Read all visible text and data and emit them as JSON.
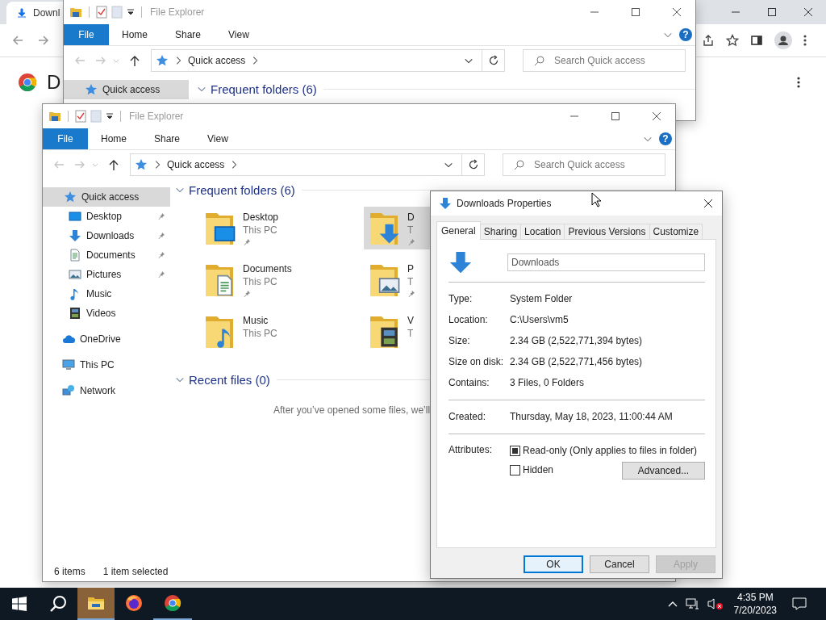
{
  "browser": {
    "tab_title": "Downl",
    "page_heading": "D"
  },
  "background_explorer": {
    "title": "File Explorer",
    "ribbon_tabs": [
      {
        "label": "File",
        "kind": "menu"
      },
      {
        "label": "Home",
        "kind": "tab"
      },
      {
        "label": "Share",
        "kind": "tab"
      },
      {
        "label": "View",
        "kind": "tab"
      }
    ],
    "help": "?",
    "address": "Quick access",
    "search_placeholder": "Search Quick access",
    "nav_item": {
      "label": "Quick access",
      "selected": true
    },
    "section": "Frequent folders (6)"
  },
  "explorer": {
    "title": "File Explorer",
    "ribbon_tabs": [
      {
        "label": "File",
        "kind": "menu"
      },
      {
        "label": "Home",
        "kind": "tab"
      },
      {
        "label": "Share",
        "kind": "tab"
      },
      {
        "label": "View",
        "kind": "tab"
      }
    ],
    "help": "?",
    "address": "Quick access",
    "search_placeholder": "Search Quick access",
    "nav": [
      {
        "label": "Quick access",
        "selected": true,
        "children": [
          {
            "label": "Desktop",
            "pinned": true,
            "selected": false
          },
          {
            "label": "Downloads",
            "pinned": true,
            "selected": false
          },
          {
            "label": "Documents",
            "pinned": true,
            "selected": false
          },
          {
            "label": "Pictures",
            "pinned": true,
            "selected": false
          },
          {
            "label": "Music",
            "pinned": false,
            "selected": false
          },
          {
            "label": "Videos",
            "pinned": false,
            "selected": false
          }
        ]
      },
      {
        "label": "OneDrive",
        "selected": false
      },
      {
        "label": "This PC",
        "selected": false
      },
      {
        "label": "Network",
        "selected": false
      }
    ],
    "frequent_heading": "Frequent folders (6)",
    "folders": [
      {
        "name": "Desktop",
        "location": "This PC",
        "pinned": true,
        "selected": false
      },
      {
        "name": "D",
        "location": "T",
        "pinned": true,
        "selected": true
      },
      {
        "name": "Documents",
        "location": "This PC",
        "pinned": true,
        "selected": false
      },
      {
        "name": "P",
        "location": "T",
        "pinned": true,
        "selected": false
      },
      {
        "name": "Music",
        "location": "This PC",
        "pinned": false,
        "selected": false
      },
      {
        "name": "V",
        "location": "T",
        "pinned": false,
        "selected": false
      }
    ],
    "recent_heading": "Recent files (0)",
    "recent_message": "After you’ve opened some files, we’ll",
    "status_items": "6 items",
    "status_selected": "1 item selected"
  },
  "dialog": {
    "title": "Downloads Properties",
    "tabs": [
      {
        "label": "General",
        "selected": true
      },
      {
        "label": "Sharing",
        "selected": false
      },
      {
        "label": "Location",
        "selected": false
      },
      {
        "label": "Previous Versions",
        "selected": false
      },
      {
        "label": "Customize",
        "selected": false
      }
    ],
    "name_value": "Downloads",
    "properties": [
      {
        "label": "Type:",
        "value": "System Folder"
      },
      {
        "label": "Location:",
        "value": "C:\\Users\\vm5"
      },
      {
        "label": "Size:",
        "value": "2.34 GB (2,522,771,394 bytes)"
      },
      {
        "label": "Size on disk:",
        "value": "2.34 GB (2,522,771,456 bytes)"
      },
      {
        "label": "Contains:",
        "value": "3 Files, 0 Folders"
      }
    ],
    "created": {
      "label": "Created:",
      "value": "Thursday, May 18, 2023, 11:00:44 AM"
    },
    "attributes_label": "Attributes:",
    "attributes": [
      {
        "label": "Read-only (Only applies to files in folder)",
        "checked": false,
        "indeterminate": true
      },
      {
        "label": "Hidden",
        "checked": false,
        "indeterminate": false
      }
    ],
    "advanced_button": "Advanced...",
    "buttons": [
      {
        "label": "OK",
        "default": true,
        "disabled": false
      },
      {
        "label": "Cancel",
        "default": false,
        "disabled": false
      },
      {
        "label": "Apply",
        "default": false,
        "disabled": true
      }
    ]
  },
  "taskbar": {
    "apps": [
      {
        "active": true,
        "running": true
      },
      {
        "active": false,
        "running": false
      },
      {
        "active": false,
        "running": true
      }
    ],
    "volume_muted": true,
    "time": "4:35 PM",
    "date": "7/20/2023"
  }
}
